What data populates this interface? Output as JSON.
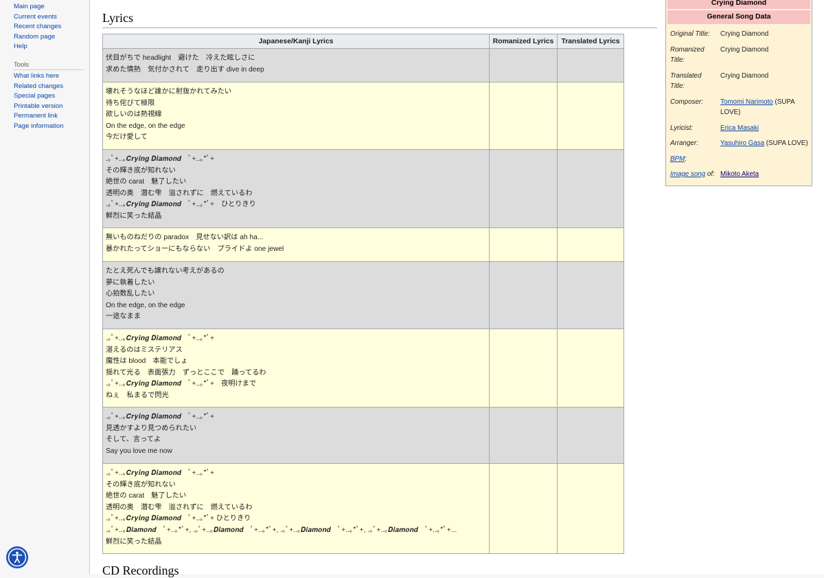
{
  "sidebar": {
    "nav": [
      "Main page",
      "Current events",
      "Recent changes",
      "Random page",
      "Help"
    ],
    "tools_heading": "Tools",
    "tools": [
      "What links here",
      "Related changes",
      "Special pages",
      "Printable version",
      "Permanent link",
      "Page information"
    ]
  },
  "accessibility_button": {
    "icon": "accessibility-icon"
  },
  "section_title": "Lyrics",
  "next_section_title": "CD Recordings",
  "table": {
    "headers": [
      "Japanese/Kanji Lyrics",
      "Romanized Lyrics",
      "Translated Lyrics"
    ],
    "rows": [
      {
        "style": "gray",
        "lines": [
          "伏目がちで headlight　避けた　冷えた眩しさに",
          "求めた情熱　気付かされて　走り出す dive in deep"
        ]
      },
      {
        "style": "yellow",
        "lines": [
          "壊れそうなほど誰かに射抜かれてみたい",
          "待ち侘びて極限",
          "欲しいのは熱視線",
          "On the edge, on the edge",
          "今だけ愛して"
        ]
      },
      {
        "style": "gray",
        "lines": [
          ".｡ﾟ+..｡𝑪𝒓𝒚𝒊𝒏𝒈 𝑫𝒊𝒂𝒎𝒐𝒏𝒅　ﾟ+..｡*ﾟ+",
          "その輝き底が知れない",
          "絶世の carat　魅了したい",
          "透明の奥　潜む雫　溢されずに　燃えているわ",
          ".｡ﾟ+..｡𝑪𝒓𝒚𝒊𝒏𝒈 𝑫𝒊𝒂𝒎𝒐𝒏𝒅　ﾟ+..｡*ﾟ+　ひとりきり",
          "鮮烈に笑った結晶"
        ]
      },
      {
        "style": "yellow",
        "lines": [
          "無いものねだりの paradox　見せない訳は ah ha...",
          "暴かれたってショーにもならない　プライドよ one jewel"
        ]
      },
      {
        "style": "gray",
        "lines": [
          "たとえ死んでも譲れない考えがあるの",
          "夢に執着したい",
          "心拍数乱したい",
          "On the edge, on the edge",
          "一途なまま"
        ]
      },
      {
        "style": "yellow",
        "lines": [
          ".｡ﾟ+..｡𝑪𝒓𝒚𝒊𝒏𝒈 𝑫𝒊𝒂𝒎𝒐𝒏𝒅　ﾟ+..｡*ﾟ+",
          "湛えるのはミステリアス",
          "魔性は blood　本能でしょ",
          "揺れて光る　表面張力　ずっとここで　踊ってるわ",
          ".｡ﾟ+..｡𝑪𝒓𝒚𝒊𝒏𝒈 𝑫𝒊𝒂𝒎𝒐𝒏𝒅　ﾟ+..｡*ﾟ+　夜明けまで",
          "ねぇ　私まるで閃光"
        ]
      },
      {
        "style": "gray",
        "lines": [
          ".｡ﾟ+..｡𝑪𝒓𝒚𝒊𝒏𝒈 𝑫𝒊𝒂𝒎𝒐𝒏𝒅　ﾟ+..｡*ﾟ+",
          "見透かすより見つめられたい",
          "そして、言ってよ",
          "Say you love me now"
        ]
      },
      {
        "style": "yellow",
        "lines": [
          ".｡ﾟ+..｡𝑪𝒓𝒚𝒊𝒏𝒈 𝑫𝒊𝒂𝒎𝒐𝒏𝒅　ﾟ+..｡*ﾟ+",
          "その輝き底が知れない",
          "絶世の carat　魅了したい",
          "透明の奥　潜む雫　溢されずに　燃えているわ",
          ".｡ﾟ+..｡𝑪𝒓𝒚𝒊𝒏𝒈 𝑫𝒊𝒂𝒎𝒐𝒏𝒅　ﾟ+..｡*ﾟ+ ひとりきり",
          ".｡ﾟ+..｡𝑫𝒊𝒂𝒎𝒐𝒏𝒅　ﾟ+..｡*ﾟ+, .｡ﾟ+..｡𝑫𝒊𝒂𝒎𝒐𝒏𝒅　ﾟ+..｡*ﾟ+, .｡ﾟ+..｡𝑫𝒊𝒂𝒎𝒐𝒏𝒅　ﾟ+..｡*ﾟ+, .｡ﾟ+..｡𝑫𝒊𝒂𝒎𝒐𝒏𝒅　ﾟ+..｡*ﾟ+...",
          "鮮烈に笑った結晶"
        ]
      }
    ]
  },
  "infobox": {
    "title": "Crying Diamond",
    "subtitle": "General Song Data",
    "fields": [
      {
        "key": "Original Title:",
        "value": "Crying Diamond"
      },
      {
        "key": "Romanized Title:",
        "value": "Crying Diamond"
      },
      {
        "key": "Translated Title:",
        "value": "Crying Diamond"
      },
      {
        "key": "Composer:",
        "link": "Tomomi Narimoto",
        "suffix": " (SUPA LOVE)"
      },
      {
        "key": "Lyricist:",
        "link": "Erica Masaki",
        "suffix": ""
      },
      {
        "key": "Arranger:",
        "link": "Yasuhiro Gasa",
        "suffix": " (SUPA LOVE)"
      },
      {
        "key_link": "BPM",
        "key_suffix": ":",
        "value": ""
      },
      {
        "key_link": "Image song",
        "key_suffix": " of:",
        "link": "Mikoto Aketa",
        "suffix": ""
      }
    ]
  },
  "colors": {
    "link": "#0645ad",
    "row_gray": "#dcdcdc",
    "row_yellow": "#ffffdd",
    "infobox_bg": "#fff3d6",
    "infobox_header": "#f7c3c3",
    "a11y_button": "#1e50b4"
  }
}
